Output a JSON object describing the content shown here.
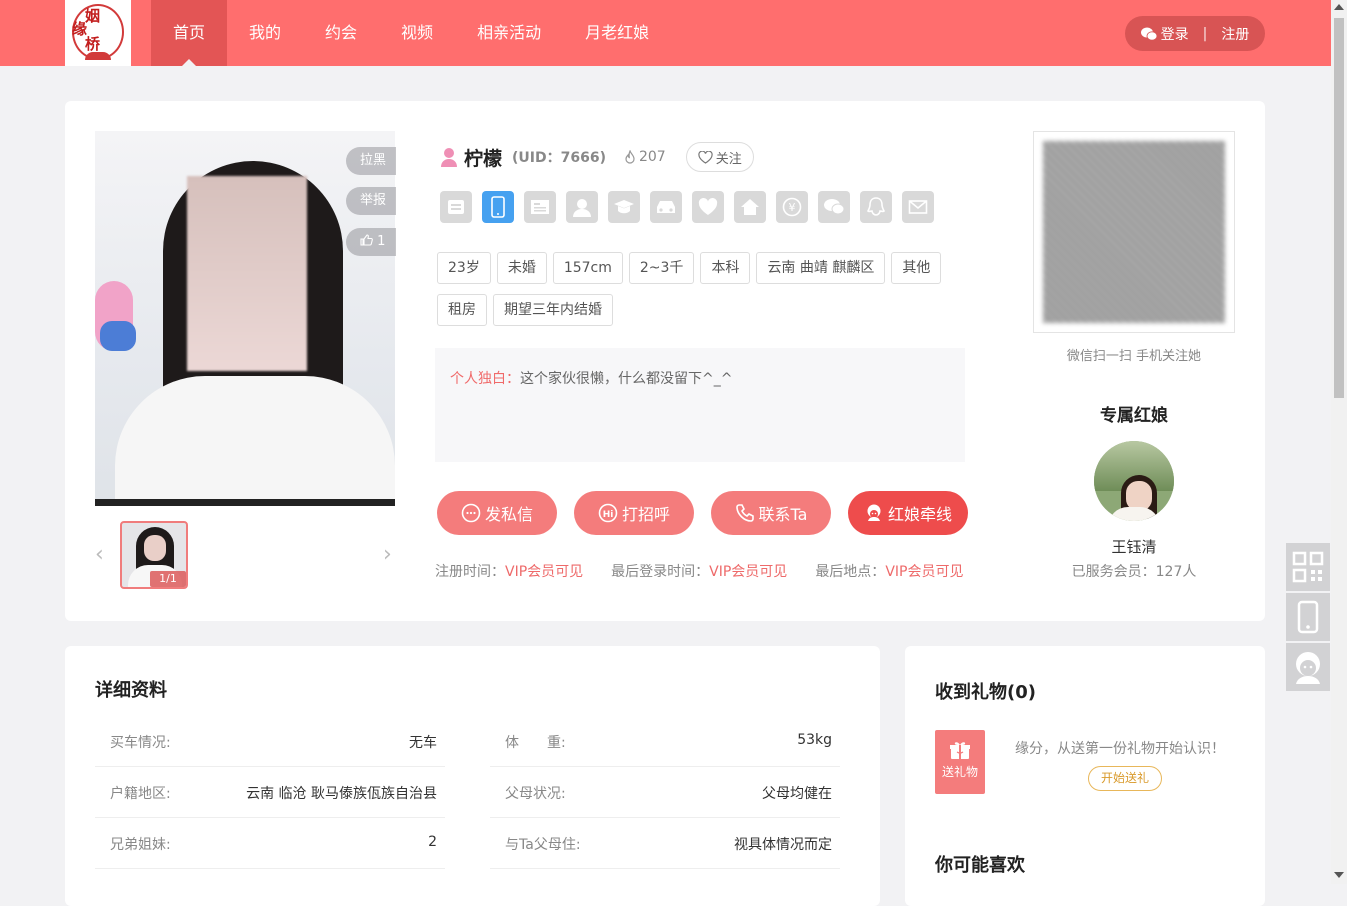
{
  "logo": {
    "l1": "姻",
    "l2": "缘",
    "l3": "桥"
  },
  "nav": {
    "items": [
      {
        "label": "首页",
        "active": true
      },
      {
        "label": "我的"
      },
      {
        "label": "约会"
      },
      {
        "label": "视频"
      },
      {
        "label": "相亲活动"
      },
      {
        "label": "月老红娘"
      }
    ]
  },
  "auth": {
    "login": "登录",
    "sep": "|",
    "register": "注册"
  },
  "photo": {
    "block_label": "拉黑",
    "report_label": "举报",
    "like_count": "1",
    "counter": "1/1"
  },
  "profile": {
    "nickname": "柠檬",
    "uid": "(UID：7666)",
    "heat": "207",
    "follow_label": "关注",
    "tags": [
      "23岁",
      "未婚",
      "157cm",
      "2~3千",
      "本科",
      "云南 曲靖 麒麟区",
      "其他",
      "租房",
      "期望三年内结婚"
    ],
    "monologue_label": "个人独白：",
    "monologue_text": "这个家伙很懒，什么都没留下^_^",
    "actions": [
      {
        "label": "发私信",
        "icon": "chat-icon"
      },
      {
        "label": "打招呼",
        "icon": "hi-icon"
      },
      {
        "label": "联系Ta",
        "icon": "phone-icon"
      },
      {
        "label": "红娘牵线",
        "icon": "matchmaker-icon"
      }
    ],
    "meta": [
      {
        "key": "注册时间：",
        "value": "VIP会员可见"
      },
      {
        "key": "最后登录时间：",
        "value": "VIP会员可见"
      },
      {
        "key": "最后地点：",
        "value": "VIP会员可见"
      }
    ],
    "verify_icons": [
      "idcard-icon",
      "mobile-icon",
      "education-cert-icon",
      "avatar-icon",
      "degree-icon",
      "car-icon",
      "marriage-icon",
      "house-icon",
      "income-icon",
      "wechat-icon",
      "qq-icon",
      "email-icon"
    ]
  },
  "qr": {
    "tip": "微信扫一扫 手机关注她"
  },
  "hongniang": {
    "title": "专属红娘",
    "name": "王钰清",
    "served": "已服务会员：127人"
  },
  "detail": {
    "title": "详细资料",
    "left": [
      {
        "k": "买车情况:",
        "v": "无车"
      },
      {
        "k": "户籍地区:",
        "v": "云南 临沧 耿马傣族佤族自治县"
      },
      {
        "k": "兄弟姐妹:",
        "v": "2"
      }
    ],
    "right": [
      {
        "k": "体　　重:",
        "v": "53kg"
      },
      {
        "k": "父母状况:",
        "v": "父母均健在"
      },
      {
        "k": "与Ta父母住:",
        "v": "视具体情况而定"
      }
    ]
  },
  "gifts": {
    "title": "收到礼物(0)",
    "send_label": "送礼物",
    "tip": "缘分，从送第一份礼物开始认识！",
    "start_label": "开始送礼",
    "like_title": "你可能喜欢"
  },
  "colors": {
    "brand": "#ff6e6e",
    "accent": "#f47c7c",
    "strong": "#ee4c4c",
    "verified": "#46a1f0"
  }
}
